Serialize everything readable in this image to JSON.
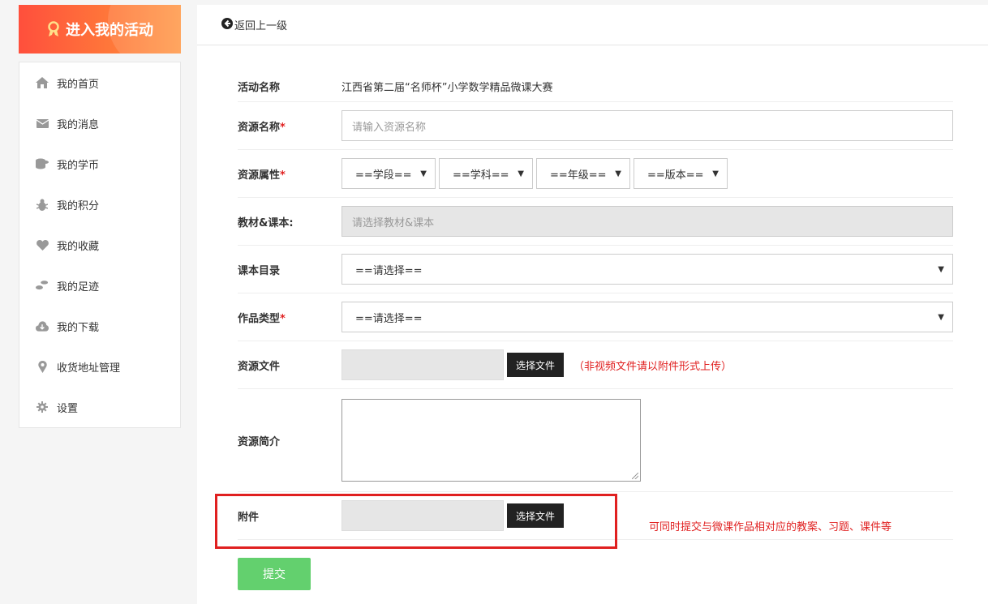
{
  "sidebar": {
    "banner_label": "进入我的活动",
    "items": [
      {
        "label": "我的首页",
        "icon": "home-icon"
      },
      {
        "label": "我的消息",
        "icon": "envelope-icon"
      },
      {
        "label": "我的学币",
        "icon": "coins-icon"
      },
      {
        "label": "我的积分",
        "icon": "bug-icon"
      },
      {
        "label": "我的收藏",
        "icon": "heart-icon"
      },
      {
        "label": "我的足迹",
        "icon": "footprints-icon"
      },
      {
        "label": "我的下载",
        "icon": "cloud-download-icon"
      },
      {
        "label": "收货地址管理",
        "icon": "map-marker-icon"
      },
      {
        "label": "设置",
        "icon": "gear-icon"
      }
    ]
  },
  "topbar": {
    "back_label": "返回上一级"
  },
  "form": {
    "activity_name_label": "活动名称",
    "activity_name_value": "江西省第二届“名师杯”小学数学精品微课大赛",
    "resource_name_label": "资源名称",
    "resource_name_placeholder": "请输入资源名称",
    "resource_attr_label": "资源属性",
    "selects": {
      "stage": "==学段==",
      "subject": "==学科==",
      "grade": "==年级==",
      "edition": "==版本=="
    },
    "textbook_label": "教材&课本:",
    "textbook_placeholder": "请选择教材&课本",
    "catalog_label": "课本目录",
    "catalog_value": "==请选择==",
    "work_type_label": "作品类型",
    "work_type_value": "==请选择==",
    "resource_file_label": "资源文件",
    "choose_file_label": "选择文件",
    "resource_file_hint": "（非视频文件请以附件形式上传）",
    "intro_label": "资源简介",
    "attachment_label": "附件",
    "attachment_choose_label": "选择文件",
    "attachment_hint": "可同时提交与微课作品相对应的教案、习题、课件等",
    "required_mark": "*",
    "submit_label": "提交"
  },
  "colors": {
    "banner": "#ff5a3c",
    "required": "#e02020",
    "submit": "#63d06e",
    "highlight_box": "#e02020"
  }
}
